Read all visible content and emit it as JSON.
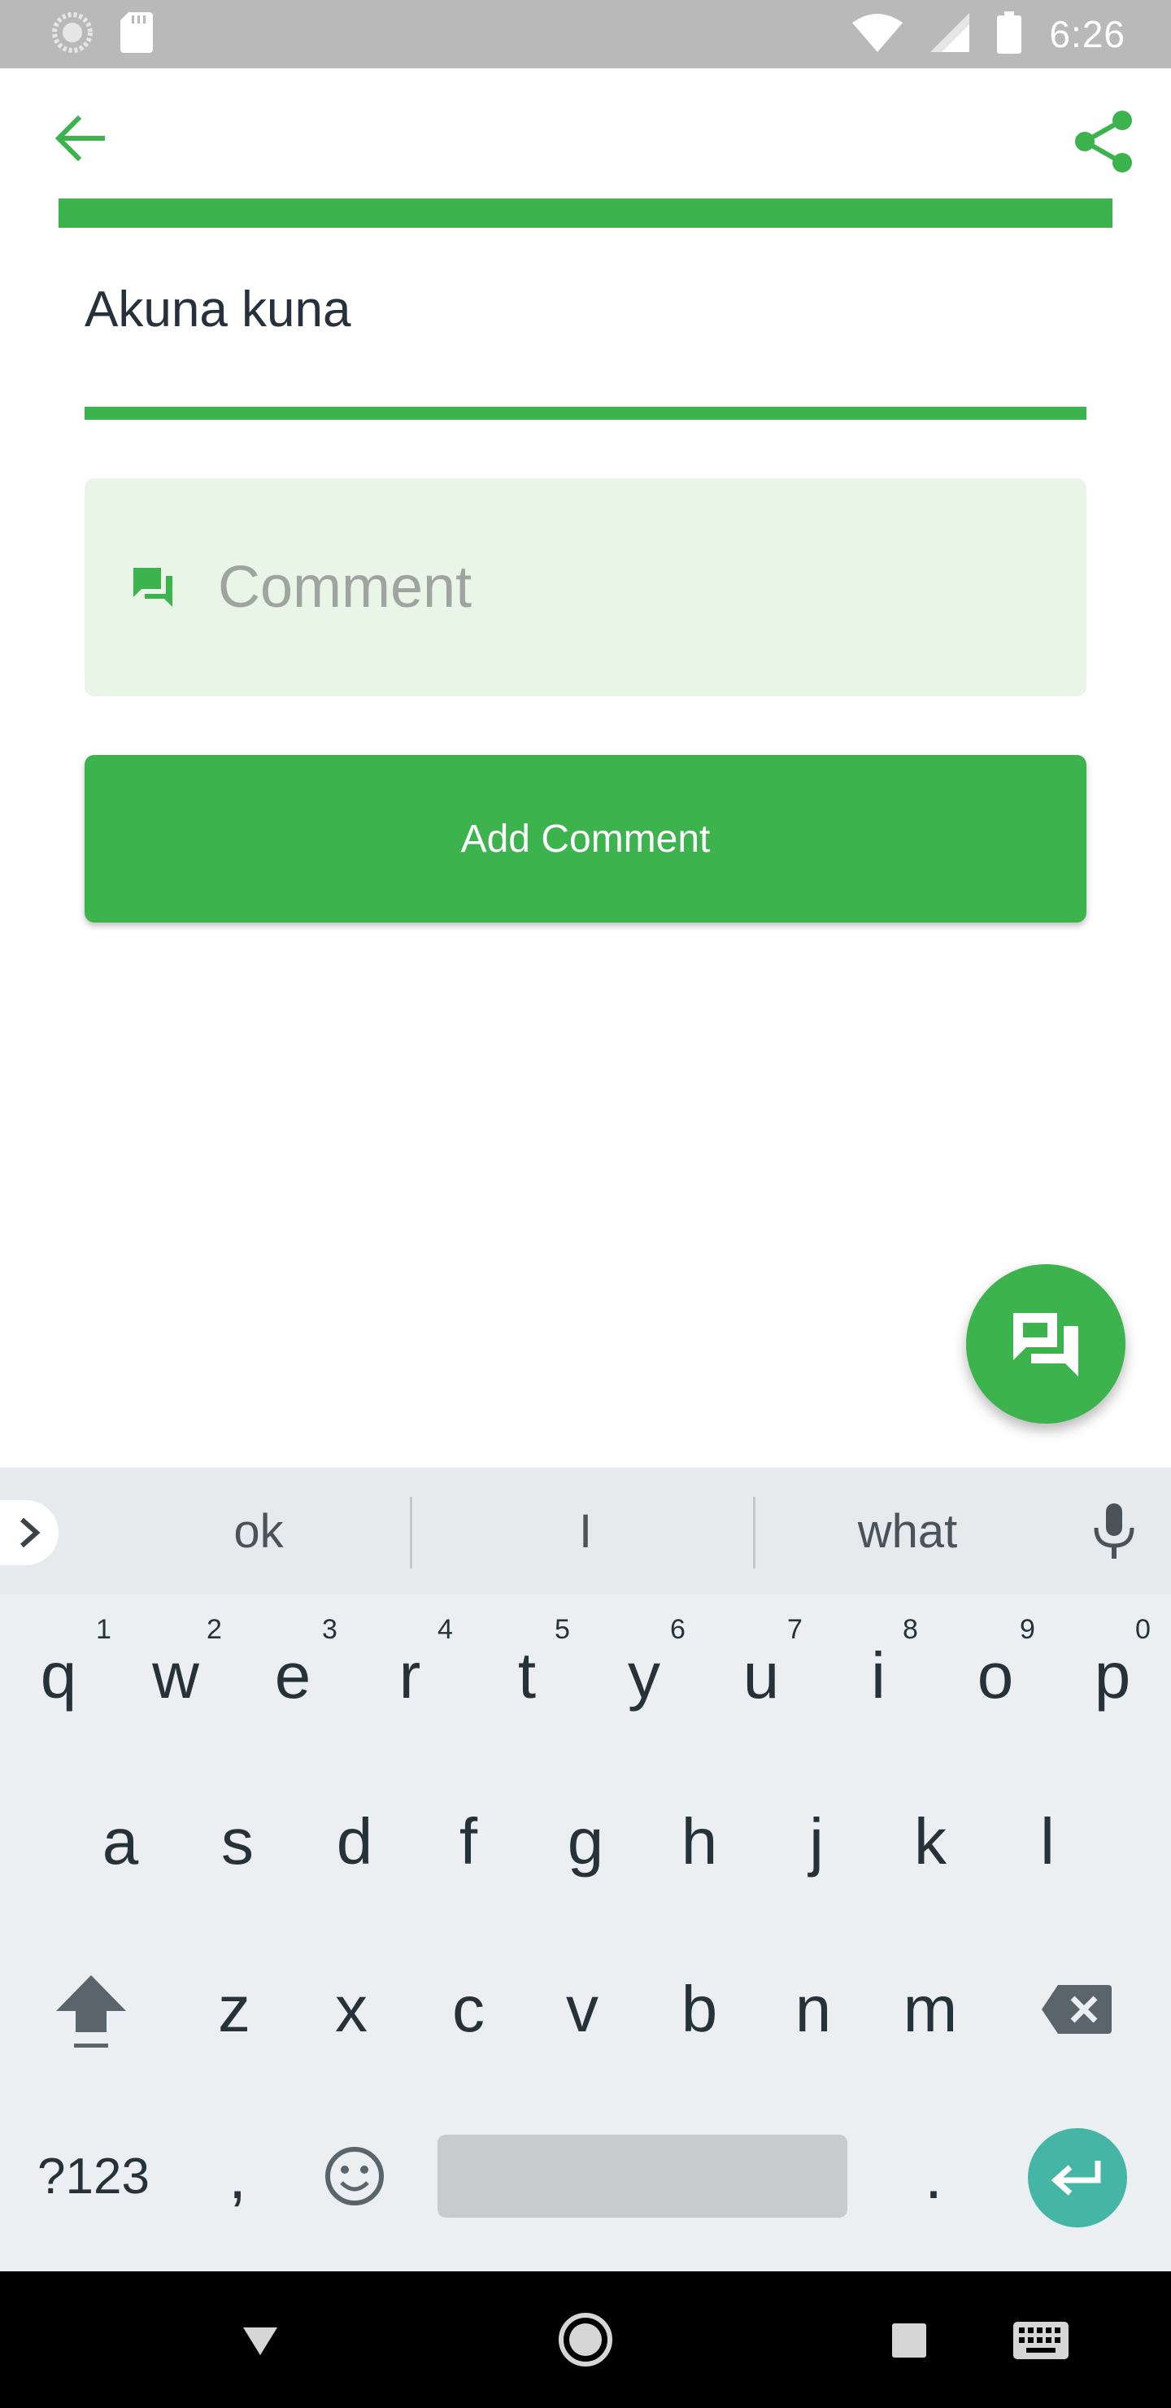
{
  "status_bar": {
    "time": "6:26",
    "icons": [
      "sync-icon",
      "sd-card-icon",
      "wifi-icon",
      "signal-icon",
      "battery-icon"
    ]
  },
  "app_bar": {
    "back_icon": "arrow-left-icon",
    "share_icon": "share-icon"
  },
  "post": {
    "title": "Akuna kuna"
  },
  "comment_field": {
    "placeholder": "Comment",
    "value": "",
    "icon": "forum-icon"
  },
  "add_comment_button": {
    "label": "Add Comment"
  },
  "fab": {
    "icon": "forum-icon"
  },
  "colors": {
    "accent": "#3cb34d",
    "field_bg": "#e8f5e7",
    "enter_key": "#45b5a6"
  },
  "keyboard": {
    "suggestions": [
      "ok",
      "I",
      "what"
    ],
    "row1": [
      "q",
      "w",
      "e",
      "r",
      "t",
      "y",
      "u",
      "i",
      "o",
      "p"
    ],
    "row1_hints": [
      "1",
      "2",
      "3",
      "4",
      "5",
      "6",
      "7",
      "8",
      "9",
      "0"
    ],
    "row2": [
      "a",
      "s",
      "d",
      "f",
      "g",
      "h",
      "j",
      "k",
      "l"
    ],
    "row3": [
      "z",
      "x",
      "c",
      "v",
      "b",
      "n",
      "m"
    ],
    "symbols_key": "?123",
    "comma_key": ",",
    "period_key": "."
  },
  "nav_bar": {
    "icons": [
      "back-triangle-icon",
      "home-circle-icon",
      "recents-square-icon",
      "keyboard-icon"
    ]
  }
}
